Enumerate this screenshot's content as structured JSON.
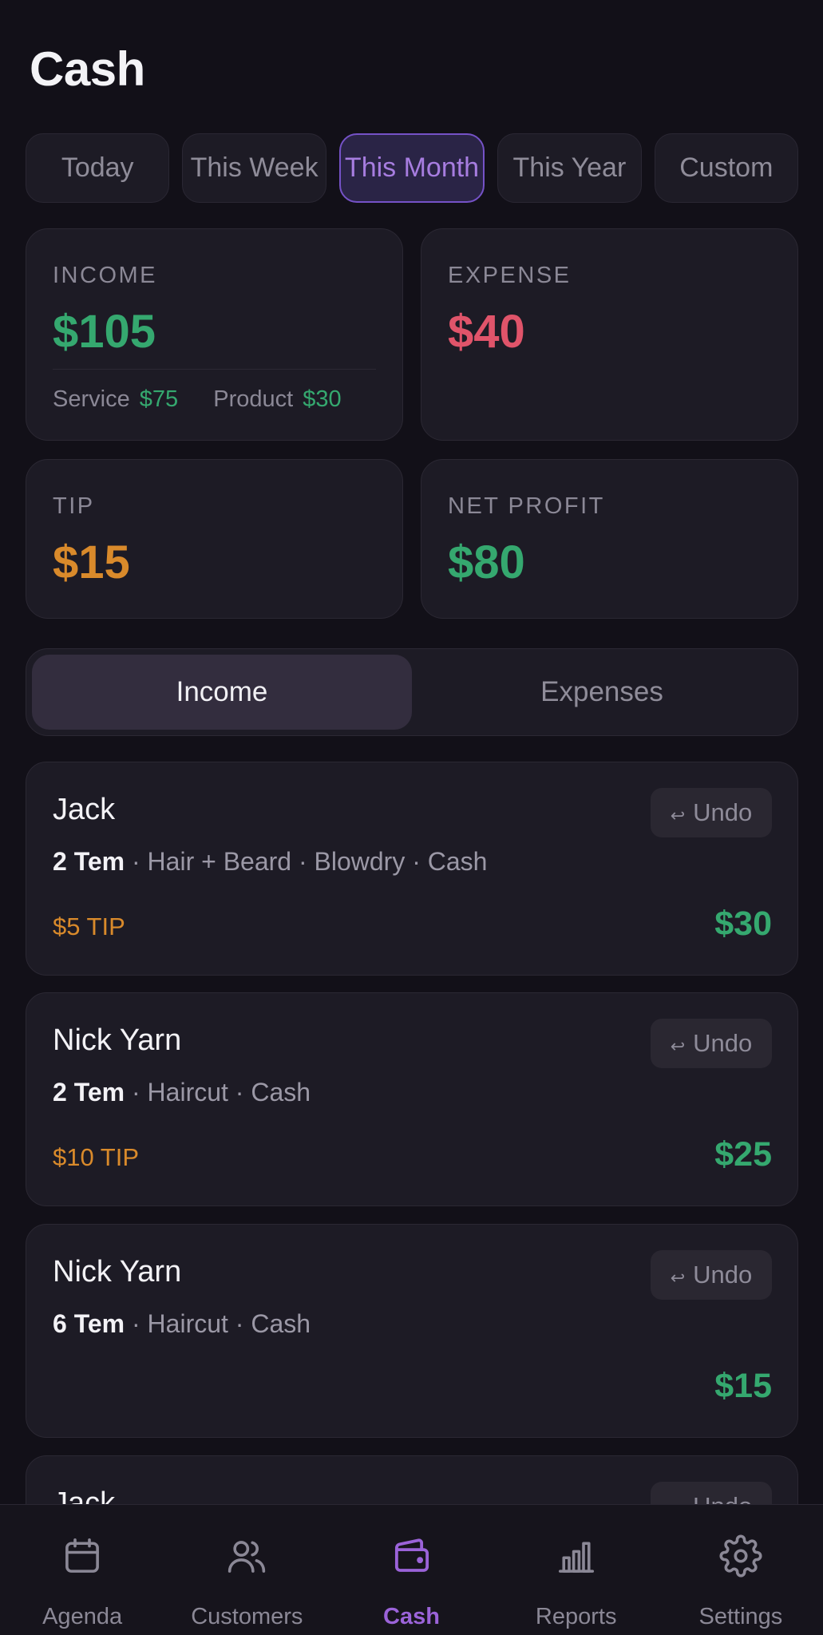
{
  "header": {
    "title": "Cash"
  },
  "periods": [
    "Today",
    "This Week",
    "This Month",
    "This Year",
    "Custom"
  ],
  "active_period": "This Month",
  "stats": {
    "income": {
      "label": "INCOME",
      "value": "$105",
      "service_label": "Service",
      "service_value": "$75",
      "product_label": "Product",
      "product_value": "$30"
    },
    "expense": {
      "label": "EXPENSE",
      "value": "$40"
    },
    "tip": {
      "label": "TIP",
      "value": "$15"
    },
    "net_profit": {
      "label": "NET PROFIT",
      "value": "$80"
    }
  },
  "segments": {
    "income": "Income",
    "expenses": "Expenses",
    "active": "Income"
  },
  "transactions": [
    {
      "name": "Jack",
      "staff": "2 Tem",
      "details": " · Hair + Beard · Blowdry · Cash",
      "tip": "$5 TIP",
      "amount": "$30",
      "undo": "Undo"
    },
    {
      "name": "Nick Yarn",
      "staff": "2 Tem",
      "details": " · Haircut · Cash",
      "tip": "$10 TIP",
      "amount": "$25",
      "undo": "Undo"
    },
    {
      "name": "Nick Yarn",
      "staff": "6 Tem",
      "details": " · Haircut · Cash",
      "tip": "",
      "amount": "$15",
      "undo": "Undo"
    },
    {
      "name": "Jack",
      "staff": "",
      "details": "",
      "tip": "",
      "amount": "",
      "undo": "Undo"
    }
  ],
  "nav": {
    "items": [
      {
        "label": "Agenda",
        "icon": "calendar-icon"
      },
      {
        "label": "Customers",
        "icon": "users-icon"
      },
      {
        "label": "Cash",
        "icon": "wallet-icon"
      },
      {
        "label": "Reports",
        "icon": "bar-chart-icon"
      },
      {
        "label": "Settings",
        "icon": "gear-icon"
      }
    ],
    "active": "Cash"
  },
  "colors": {
    "background": "#121018",
    "card": "#1d1b25",
    "accent": "#9b63d9",
    "income_green": "#35a86f",
    "expense_red": "#e0546a",
    "tip_orange": "#d98a2b"
  }
}
